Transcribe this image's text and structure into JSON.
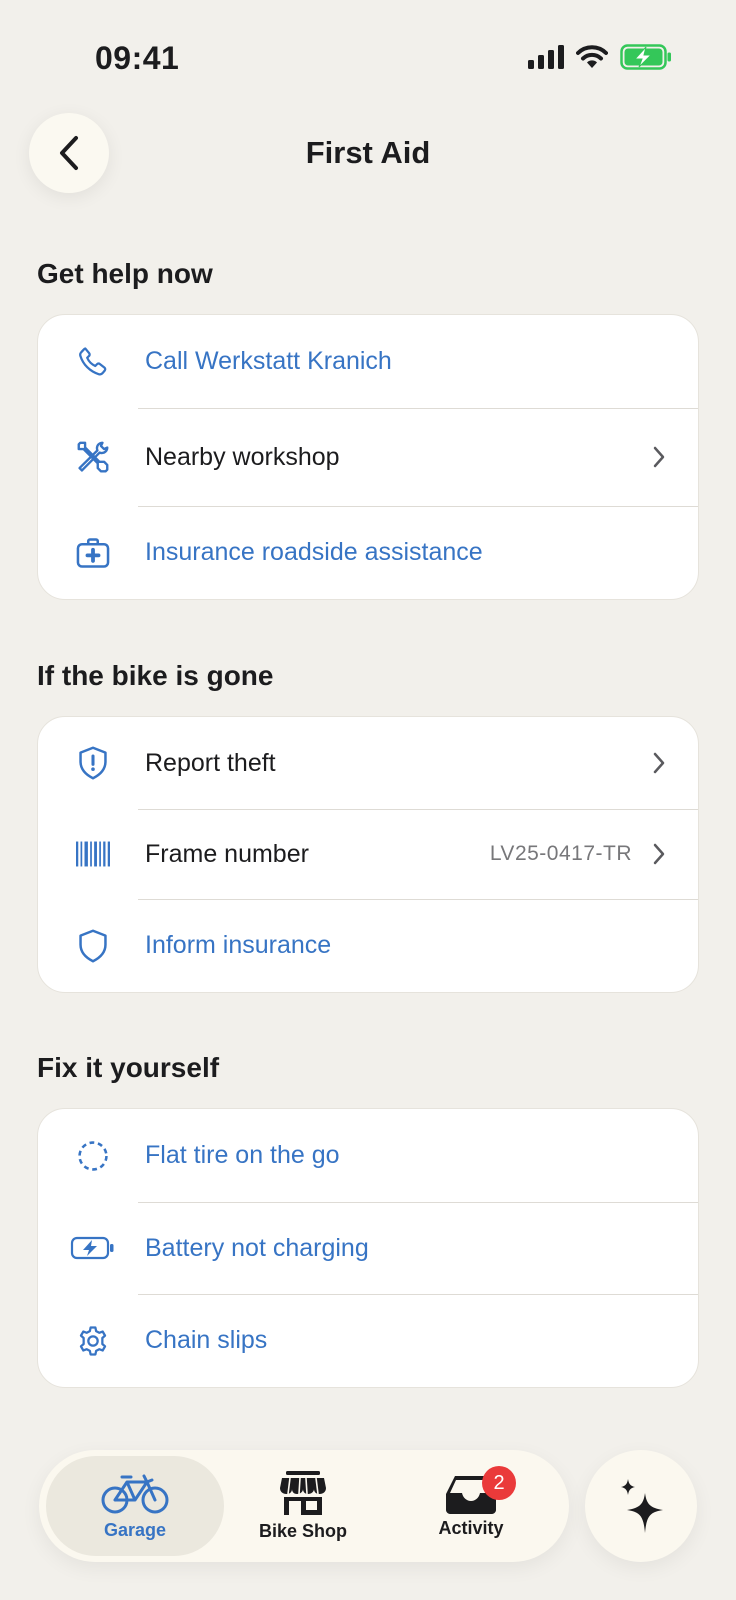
{
  "status_bar": {
    "time": "09:41"
  },
  "header": {
    "title": "First Aid"
  },
  "sections": [
    {
      "title": "Get help now",
      "rows": [
        {
          "label": "Call Werkstatt Kranich",
          "icon": "phone-icon"
        },
        {
          "label": "Nearby workshop",
          "icon": "tools-icon"
        },
        {
          "label": "Insurance roadside assistance",
          "icon": "medical-kit-icon"
        }
      ]
    },
    {
      "title": "If the bike is gone",
      "rows": [
        {
          "label": "Report theft",
          "icon": "shield-alert-icon"
        },
        {
          "label": "Frame number",
          "value": "LV25-0417-TR",
          "icon": "barcode-icon"
        },
        {
          "label": "Inform insurance",
          "icon": "shield-icon"
        }
      ]
    },
    {
      "title": "Fix it yourself",
      "rows": [
        {
          "label": "Flat tire on the go",
          "icon": "dashed-circle-icon"
        },
        {
          "label": "Battery not charging",
          "icon": "battery-charging-icon"
        },
        {
          "label": "Chain slips",
          "icon": "gear-icon"
        }
      ]
    }
  ],
  "tab_bar": {
    "tabs": [
      {
        "label": "Garage",
        "icon": "bicycle-icon",
        "active": true
      },
      {
        "label": "Bike Shop",
        "icon": "store-icon"
      },
      {
        "label": "Activity",
        "icon": "inbox-icon",
        "badge": "2"
      }
    ]
  },
  "colors": {
    "accent": "#3774c4",
    "badge": "#ea3a3a",
    "background": "#f2f0eb",
    "battery": "#34c759"
  }
}
